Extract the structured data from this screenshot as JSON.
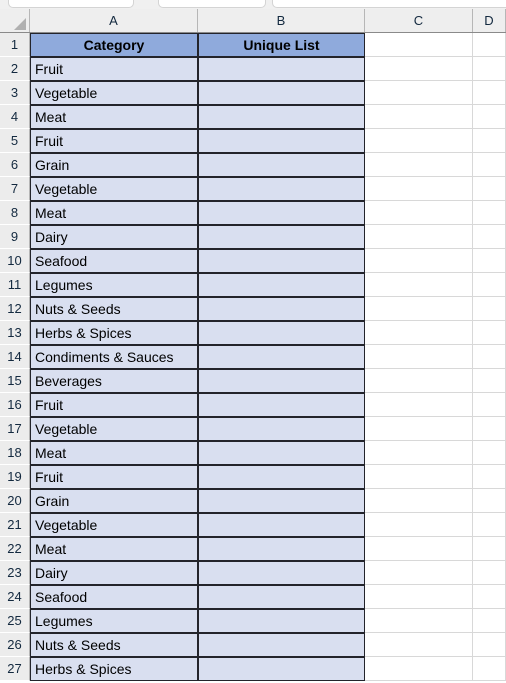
{
  "app": {
    "type": "spreadsheet",
    "ribbon_groups": [
      "ribbon-group-1",
      "ribbon-group-2",
      "ribbon-group-3"
    ]
  },
  "grid": {
    "corner_name": "select-all-corner",
    "column_headers": [
      "A",
      "B",
      "C",
      "D"
    ],
    "row_headers": [
      1,
      2,
      3,
      4,
      5,
      6,
      7,
      8,
      9,
      10,
      11,
      12,
      13,
      14,
      15,
      16,
      17,
      18,
      19,
      20,
      21,
      22,
      23,
      24,
      25,
      26,
      27
    ],
    "first_data_row": 2,
    "last_visible_row": 27
  },
  "table": {
    "headers": {
      "A1": "Category",
      "B1": "Unique List"
    },
    "column_a_values": [
      "Fruit",
      "Vegetable",
      "Meat",
      "Fruit",
      "Grain",
      "Vegetable",
      "Meat",
      "Dairy",
      "Seafood",
      "Legumes",
      "Nuts & Seeds",
      "Herbs & Spices",
      "Condiments & Sauces",
      "Beverages",
      "Fruit",
      "Vegetable",
      "Meat",
      "Fruit",
      "Grain",
      "Vegetable",
      "Meat",
      "Dairy",
      "Seafood",
      "Legumes",
      "Nuts & Seeds",
      "Herbs & Spices"
    ],
    "column_b_values": [
      "",
      "",
      "",
      "",
      "",
      "",
      "",
      "",
      "",
      "",
      "",
      "",
      "",
      "",
      "",
      "",
      "",
      "",
      "",
      "",
      "",
      "",
      "",
      "",
      "",
      ""
    ]
  },
  "colors": {
    "header_fill": "#8FAADC",
    "data_fill": "#D9DFF0",
    "cell_border": "#23242B",
    "row_header_fill": "#ECECEC",
    "col_header_fill": "#EEEEEE",
    "gridline": "#D8D8D8"
  }
}
